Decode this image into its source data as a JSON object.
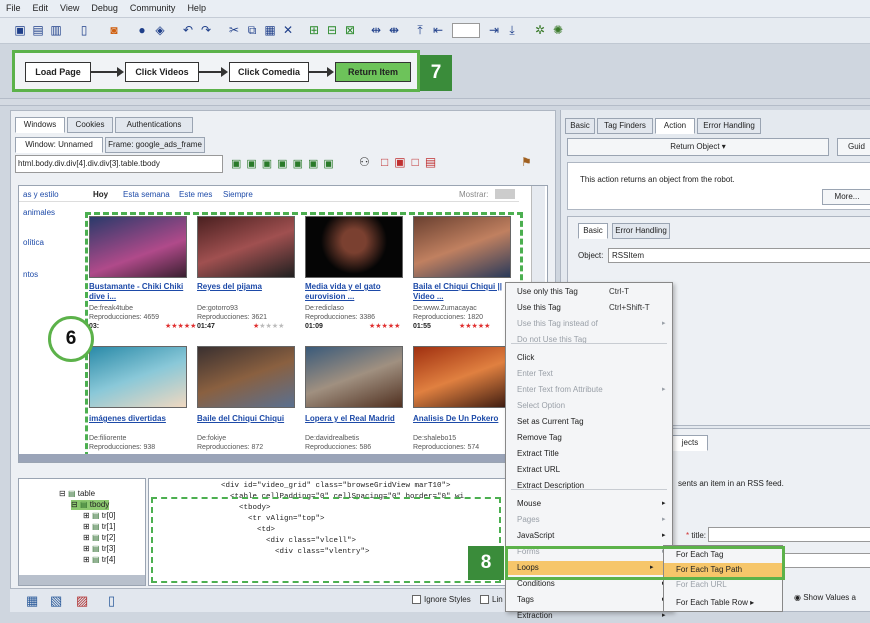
{
  "menubar": {
    "items": [
      "File",
      "Edit",
      "View",
      "Debug",
      "Community",
      "Help"
    ]
  },
  "flow": {
    "steps": [
      "Load Page",
      "Click Videos",
      "Click Comedia",
      "Return Item"
    ],
    "badge_7": "7",
    "badge_6": "6",
    "badge_8": "8"
  },
  "left_tabs": [
    "Windows",
    "Cookies",
    "Authentications"
  ],
  "window_tabs": {
    "window": "Window: Unnamed",
    "frame": "Frame: google_ads_frame"
  },
  "path_text": "html.body.div.div[4].div.div[3].table.tbody",
  "browser": {
    "sidebar": [
      "as y estilo",
      "animales",
      "olítica",
      "ntos"
    ],
    "filters": [
      "Hoy",
      "Esta semana",
      "Este mes",
      "Siempre"
    ],
    "show_label": "Mostrar:",
    "videos": [
      {
        "title": "Bustamante - Chiki Chiki dive i...",
        "user": "De:freak4tube",
        "views": "Reproducciones: 4659",
        "time": "03:"
      },
      {
        "title": "Reyes del pijama",
        "user": "De:gotorro93",
        "views": "Reproducciones: 3621",
        "time": "01:47"
      },
      {
        "title": "Media vida y el gato eurovision ...",
        "user": "De:rediclaso",
        "views": "Reproducciones: 3386",
        "time": "01:09"
      },
      {
        "title": "Baila el Chiqui Chiqui || Video ...",
        "user": "De:www.Zumacayac",
        "views": "Reproducciones: 1820",
        "time": "01:55"
      },
      {
        "title": "imágenes divertidas",
        "user": "De:filiorente",
        "views": "Reproducciones: 938",
        "time": ""
      },
      {
        "title": "Baile del Chiqui Chiqui",
        "user": "De:fokiye",
        "views": "Reproducciones: 872",
        "time": ""
      },
      {
        "title": "Lopera y el Real Madrid",
        "user": "De:davidrealbetis",
        "views": "Reproducciones: 586",
        "time": ""
      },
      {
        "title": "Analisis De Un Pokero",
        "user": "De:shalebo15",
        "views": "Reproducciones: 574",
        "time": ""
      }
    ]
  },
  "context_menu": [
    {
      "label": "Use only this Tag",
      "shortcut": "Ctrl-T",
      "disabled": false
    },
    {
      "label": "Use this Tag",
      "shortcut": "Ctrl+Shift-T",
      "disabled": false
    },
    {
      "label": "Use this Tag instead of",
      "shortcut": "",
      "disabled": true
    },
    {
      "label": "Do not Use this Tag",
      "shortcut": "",
      "disabled": true
    },
    {
      "label": "Click",
      "shortcut": "",
      "disabled": false
    },
    {
      "label": "Enter Text",
      "shortcut": "",
      "disabled": true
    },
    {
      "label": "Enter Text from Attribute",
      "shortcut": "",
      "disabled": true
    },
    {
      "label": "Select Option",
      "shortcut": "",
      "disabled": true
    },
    {
      "label": "Set as Current Tag",
      "shortcut": "",
      "disabled": false
    },
    {
      "label": "Remove Tag",
      "shortcut": "",
      "disabled": false
    },
    {
      "label": "Extract Title",
      "shortcut": "",
      "disabled": false
    },
    {
      "label": "Extract URL",
      "shortcut": "",
      "disabled": false
    },
    {
      "label": "Extract Description",
      "shortcut": "",
      "disabled": false
    },
    {
      "label": "Mouse",
      "shortcut": "",
      "disabled": false
    },
    {
      "label": "Pages",
      "shortcut": "",
      "disabled": true
    },
    {
      "label": "JavaScript",
      "shortcut": "",
      "disabled": false
    },
    {
      "label": "Forms",
      "shortcut": "",
      "disabled": true
    },
    {
      "label": "Loops",
      "shortcut": "",
      "disabled": false
    },
    {
      "label": "Conditions",
      "shortcut": "",
      "disabled": false
    },
    {
      "label": "Tags",
      "shortcut": "",
      "disabled": false
    },
    {
      "label": "Extraction",
      "shortcut": "",
      "disabled": false
    }
  ],
  "loops_submenu": [
    "For Each Tag",
    "For Each Tag Path",
    "For Each URL",
    "For Each Table Row"
  ],
  "tree": [
    "table",
    "tbody",
    "tr[0]",
    "tr[1]",
    "tr[2]",
    "tr[3]",
    "tr[4]"
  ],
  "code_lines": [
    "<div id=\"video_grid\" class=\"browseGridView marT10\">",
    "  <table cellPadding=\"0\" cellSpacing=\"0\" border=\"0\" wi",
    "    <tbody>",
    "      <tr vAlign=\"top\">",
    "        <td>",
    "          <div class=\"vlcell\">",
    "            <div class=\"vlentry\">"
  ],
  "right": {
    "tabs": [
      "Basic",
      "Tag Finders",
      "Action",
      "Error Handling"
    ],
    "action_select": "Return Object",
    "guide_btn": "Guid",
    "description": "This action returns an object from the robot.",
    "more_btn": "More...",
    "inner_tabs": [
      "Basic",
      "Error Handling"
    ],
    "object_label": "Object:",
    "object_value": "RSSItem",
    "objects_tab": "jects",
    "rss_text": "sents an item in an RSS feed.",
    "title_label": "title:",
    "show_values": "Show Values a"
  },
  "bottom": {
    "ignore_styles": "Ignore Styles",
    "lin": "Lin"
  }
}
